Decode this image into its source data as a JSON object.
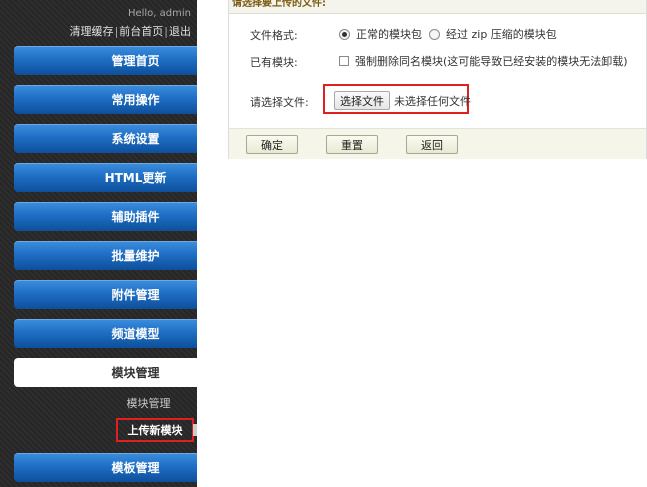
{
  "sidebar": {
    "greeting": "Hello, admin",
    "top_links": [
      "清理缓存",
      "前台首页",
      "退出"
    ],
    "separator": "|",
    "nav_items": [
      {
        "label": "管理首页"
      },
      {
        "label": "常用操作"
      },
      {
        "label": "系统设置"
      },
      {
        "label": "HTML更新"
      },
      {
        "label": "辅助插件"
      },
      {
        "label": "批量维护"
      },
      {
        "label": "附件管理"
      },
      {
        "label": "频道模型"
      },
      {
        "label": "模块管理",
        "active": true
      },
      {
        "label": "模板管理"
      }
    ],
    "sub_items": [
      "模块管理",
      "上传新模块"
    ],
    "current_sub": "上传新模块"
  },
  "form": {
    "title": "请选择要上传的文件:",
    "format_label": "文件格式:",
    "format_options": [
      {
        "label": "正常的模块包",
        "selected": true
      },
      {
        "label": "经过 zip 压缩的模块包",
        "selected": false
      }
    ],
    "existing_label": "已有模块:",
    "existing_checkbox": {
      "label": "强制删除同名模块(这可能导致已经安装的模块无法卸载)",
      "checked": false
    },
    "file_label": "请选择文件:",
    "file_button": "选择文件",
    "file_status": "未选择任何文件",
    "buttons": {
      "confirm": "确定",
      "reset": "重置",
      "back": "返回"
    }
  },
  "colors": {
    "nav_blue": "#1f6fc5",
    "highlight_red": "#e02020",
    "sidebar_bg": "#2b2b2b"
  }
}
